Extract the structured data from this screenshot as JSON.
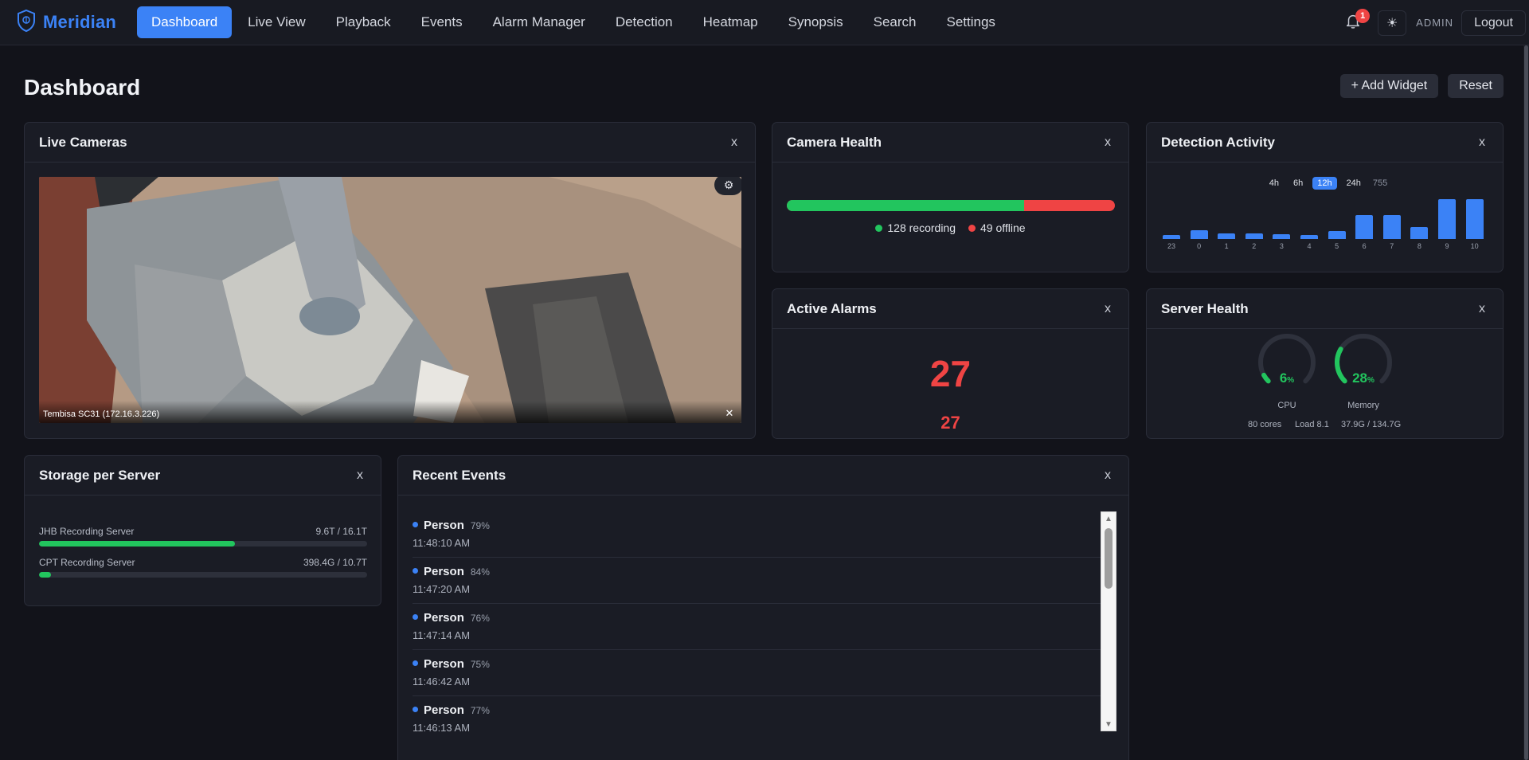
{
  "app": {
    "brand": "Meridian"
  },
  "nav": {
    "items": [
      {
        "label": "Dashboard",
        "active": true
      },
      {
        "label": "Live View"
      },
      {
        "label": "Playback"
      },
      {
        "label": "Events"
      },
      {
        "label": "Alarm Manager"
      },
      {
        "label": "Detection"
      },
      {
        "label": "Heatmap"
      },
      {
        "label": "Synopsis"
      },
      {
        "label": "Search"
      },
      {
        "label": "Settings"
      }
    ],
    "notifications": "1",
    "theme_icon": "☀",
    "user": "ADMIN",
    "logout": "Logout"
  },
  "page": {
    "title": "Dashboard",
    "add_widget": "+ Add Widget",
    "reset": "Reset"
  },
  "widgets": {
    "live_cameras": {
      "title": "Live Cameras",
      "close": "x",
      "camera_label": "Tembisa SC31 (172.16.3.226)",
      "settings_icon": "⚙",
      "close_stream_icon": "✕"
    },
    "camera_health": {
      "title": "Camera Health",
      "close": "x",
      "recording": 128,
      "offline": 49,
      "recording_label": "128 recording",
      "offline_label": "49 offline",
      "recording_color": "#22c55e",
      "offline_color": "#ef4444"
    },
    "detection_activity": {
      "title": "Detection Activity",
      "close": "x",
      "ranges": [
        "4h",
        "6h",
        "12h",
        "24h"
      ],
      "active_range": "12h",
      "total": "755"
    },
    "active_alarms": {
      "title": "Active Alarms",
      "close": "x",
      "count": "27",
      "secondary": "27"
    },
    "server_health": {
      "title": "Server Health",
      "close": "x",
      "cpu": {
        "value": 6,
        "text": "6",
        "unit": "%",
        "label": "CPU",
        "sub1": "80 cores",
        "sub2": "Load 8.1"
      },
      "memory": {
        "value": 28,
        "text": "28",
        "unit": "%",
        "label": "Memory",
        "sub": "37.9G / 134.7G"
      }
    },
    "storage": {
      "title": "Storage per Server",
      "close": "x",
      "servers": [
        {
          "name": "JHB Recording Server",
          "usage": "9.6T / 16.1T",
          "fraction": 0.596
        },
        {
          "name": "CPT Recording Server",
          "usage": "398.4G / 10.7T",
          "fraction": 0.036
        }
      ]
    },
    "recent_events": {
      "title": "Recent Events",
      "close": "x",
      "events": [
        {
          "type": "Person",
          "confidence": "79%",
          "time": "11:48:10 AM"
        },
        {
          "type": "Person",
          "confidence": "84%",
          "time": "11:47:20 AM"
        },
        {
          "type": "Person",
          "confidence": "76%",
          "time": "11:47:14 AM"
        },
        {
          "type": "Person",
          "confidence": "75%",
          "time": "11:46:42 AM"
        },
        {
          "type": "Person",
          "confidence": "77%",
          "time": "11:46:13 AM"
        }
      ]
    }
  },
  "chart_data": {
    "type": "bar",
    "categories": [
      "23",
      "0",
      "1",
      "2",
      "3",
      "4",
      "5",
      "6",
      "7",
      "8",
      "9",
      "10"
    ],
    "values": [
      4,
      9,
      6,
      6,
      5,
      4,
      8,
      24,
      24,
      12,
      40,
      40
    ],
    "ylim": [
      0,
      40
    ],
    "color": "#3b82f6",
    "grid": false
  }
}
